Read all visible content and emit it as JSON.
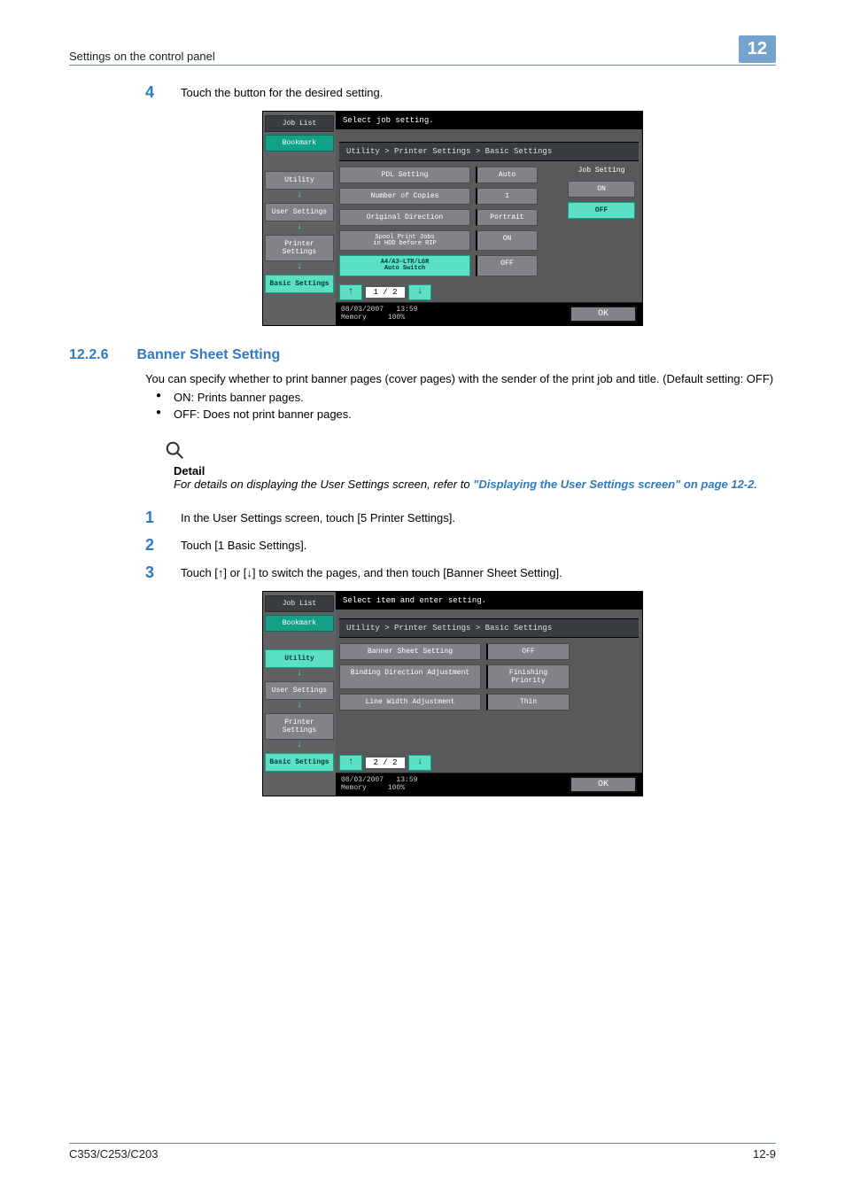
{
  "header": {
    "title": "Settings on the control panel",
    "chapter": "12"
  },
  "step4": {
    "num": "4",
    "text": "Touch the button for the desired setting."
  },
  "screen1": {
    "joblist": "Job List",
    "bookmark": "Bookmark",
    "side": {
      "utility": "Utility",
      "user": "User Settings",
      "printer": "Printer Settings",
      "basic": "Basic Settings"
    },
    "topmsg": "Select job setting.",
    "breadcrumb": "Utility > Printer Settings > Basic Settings",
    "right_header": "Job Setting",
    "on": "ON",
    "off": "OFF",
    "rows": [
      {
        "name": "PDL Setting",
        "val": "Auto"
      },
      {
        "name": "Number of Copies",
        "val": "1"
      },
      {
        "name": "Original Direction",
        "val": "Portrait"
      },
      {
        "name_line1": "Spool Print Jobs",
        "name_line2": "in HDD before RIP",
        "val": "ON"
      },
      {
        "name_line1": "A4/A3⇔LTR/LGR",
        "name_line2": "Auto Switch",
        "val": "OFF"
      }
    ],
    "page_ind": "1 / 2",
    "footer_date": "08/03/2007",
    "footer_time": "13:59",
    "footer_mem1": "Memory",
    "footer_mem2": "100%",
    "ok": "OK"
  },
  "section": {
    "num": "12.2.6",
    "title": "Banner Sheet Setting",
    "para": "You can specify whether to print banner pages (cover pages) with the sender of the print job and title. (Default setting: OFF)",
    "bullet1": "ON: Prints banner pages.",
    "bullet2": "OFF: Does not print banner pages.",
    "detail_label": "Detail",
    "detail_pre": "For details on displaying the User Settings screen, refer to ",
    "detail_link": "\"Displaying the User Settings screen\" on page 12-2",
    "detail_post": "."
  },
  "step1": {
    "num": "1",
    "text": "In the User Settings screen, touch [5 Printer Settings]."
  },
  "step2": {
    "num": "2",
    "text": "Touch [1 Basic Settings]."
  },
  "step3": {
    "num": "3",
    "text": "Touch [↑] or [↓] to switch the pages, and then touch [Banner Sheet Setting]."
  },
  "screen2": {
    "joblist": "Job List",
    "bookmark": "Bookmark",
    "side": {
      "utility": "Utility",
      "user": "User Settings",
      "printer": "Printer Settings",
      "basic": "Basic Settings"
    },
    "topmsg": "Select item and enter setting.",
    "breadcrumb": "Utility > Printer Settings > Basic Settings",
    "rows": [
      {
        "name": "Banner Sheet Setting",
        "val": "OFF"
      },
      {
        "name": "Binding Direction Adjustment",
        "val": "Finishing Priority"
      },
      {
        "name": "Line Width Adjustment",
        "val": "Thin"
      }
    ],
    "page_ind": "2 / 2",
    "footer_date": "08/03/2007",
    "footer_time": "13:59",
    "footer_mem1": "Memory",
    "footer_mem2": "100%",
    "ok": "OK"
  },
  "footer": {
    "left": "C353/C253/C203",
    "right": "12-9"
  }
}
